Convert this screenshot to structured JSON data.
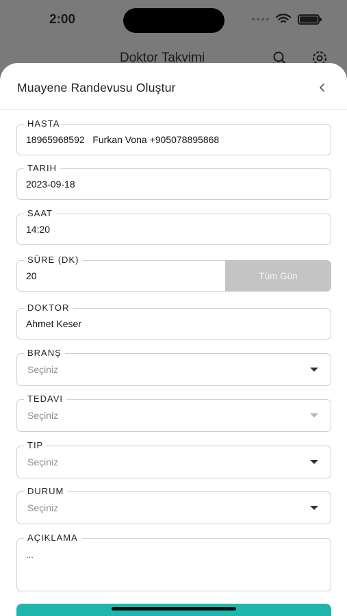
{
  "status_bar": {
    "time": "2:00"
  },
  "background_app": {
    "title": "Doktor Takvimi"
  },
  "sheet": {
    "title": "Muayene Randevusu Oluştur"
  },
  "form": {
    "hasta": {
      "label": "HASTA",
      "value": "18965968592   Furkan Vona +905078895868"
    },
    "tarih": {
      "label": "TARIH",
      "value": "2023-09-18"
    },
    "saat": {
      "label": "SAAT",
      "value": "14:20"
    },
    "sure": {
      "label": "SÜRE (DK)",
      "value": "20",
      "all_day_label": "Tüm Gün"
    },
    "doktor": {
      "label": "DOKTOR",
      "value": "Ahmet Keser"
    },
    "brans": {
      "label": "BRANŞ",
      "placeholder": "Seçiniz"
    },
    "tedavi": {
      "label": "TEDAVI",
      "placeholder": "Seçiniz"
    },
    "tip": {
      "label": "TIP",
      "placeholder": "Seçiniz"
    },
    "durum": {
      "label": "DURUM",
      "placeholder": "Seçiniz"
    },
    "aciklama": {
      "label": "AÇIKLAMA",
      "value": "..."
    }
  },
  "colors": {
    "accent": "#1fb7ad",
    "disabled_button": "#c4c4c4"
  }
}
